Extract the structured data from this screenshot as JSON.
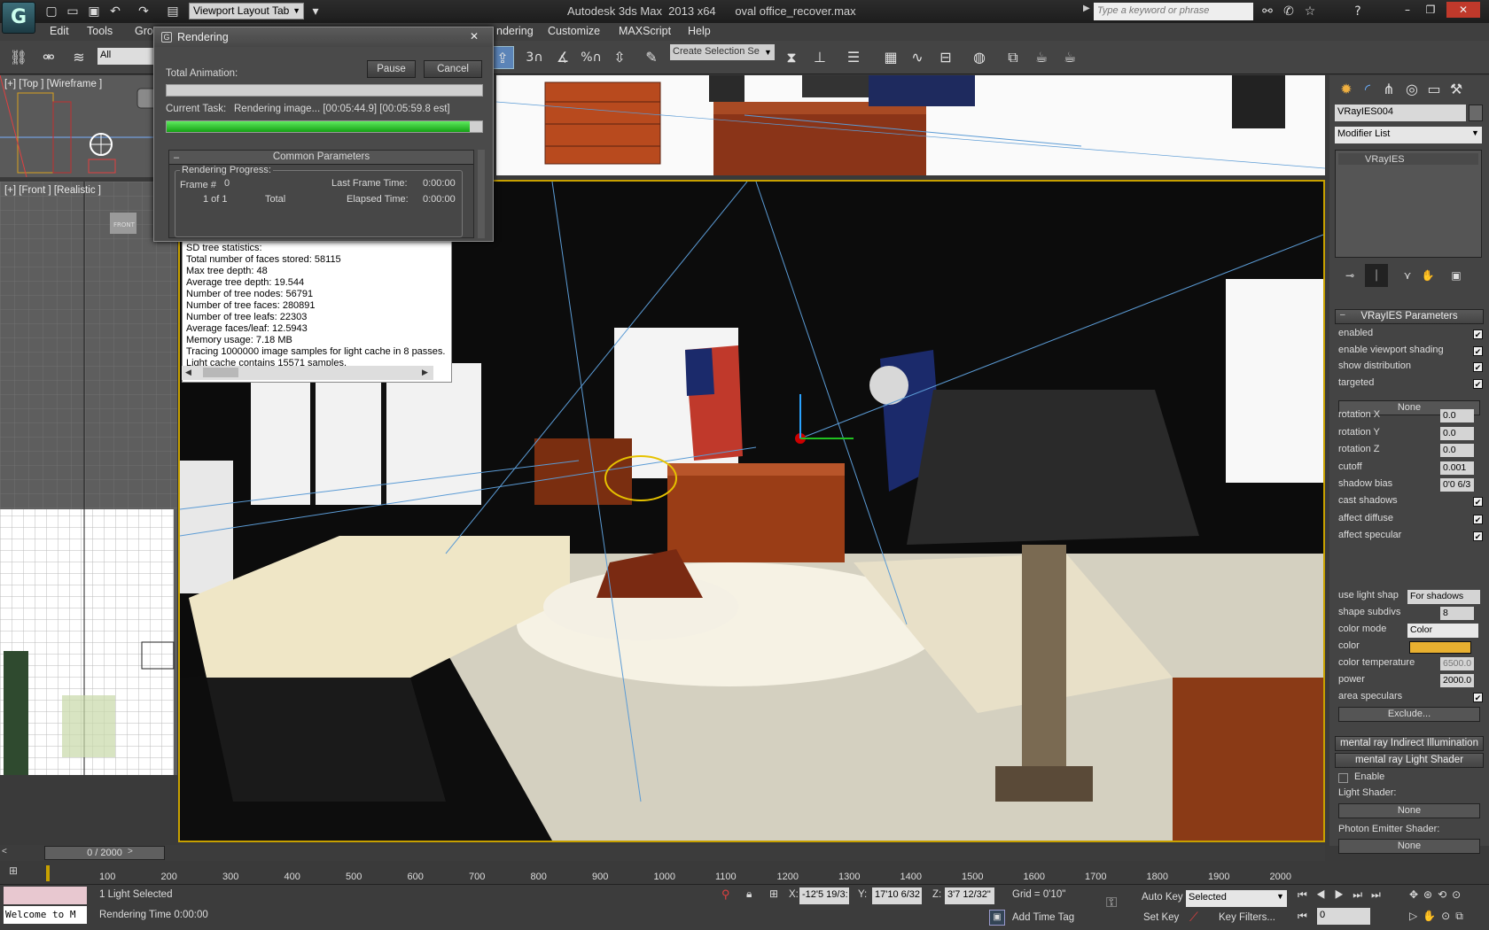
{
  "app": {
    "title": "Autodesk 3ds Max  2013 x64      oval office_recover.max",
    "logo": "G",
    "workspace": "Viewport Layout Tab",
    "search_placeholder": "Type a keyword or phrase"
  },
  "menu": [
    "Edit",
    "Tools",
    "Gro",
    "ndering",
    "Customize",
    "MAXScript",
    "Help"
  ],
  "toolbar": {
    "selection_filter": "All",
    "named_selection_placeholder": "Create Selection Se",
    "snap_labels": [
      "3",
      "%"
    ]
  },
  "viewports": {
    "top_label": "[+] [Top ] [Wireframe ]",
    "front_label": "[+] [Front ] [Realistic ]",
    "front_tag": "FRONT"
  },
  "render_dialog": {
    "title": "Rendering",
    "total_animation_label": "Total Animation:",
    "pause_label": "Pause",
    "cancel_label": "Cancel",
    "current_task_label": "Current Task:",
    "current_task_value": "Rendering image... [00:05:44.9] [00:05:59.8 est]",
    "current_task_progress": 0.96,
    "total_animation_progress": 0.0,
    "common_params_header": "Common Parameters",
    "rendering_progress_label": "Rendering Progress:",
    "frame_label": "Frame #",
    "frame_value": "0",
    "frame_of": "1 of 1",
    "total_label": "Total",
    "last_frame_time_label": "Last Frame Time:",
    "last_frame_time_value": "0:00:00",
    "elapsed_time_label": "Elapsed Time:",
    "elapsed_time_value": "0:00:00"
  },
  "log_lines": [
    "SD tree statistics:",
    "Total number of faces stored: 58115",
    "Max tree depth: 48",
    "Average tree depth: 19.544",
    "Number of tree nodes: 56791",
    "Number of tree faces: 280891",
    "Number of tree leafs: 22303",
    "Average faces/leaf: 12.5943",
    "Memory usage: 7.18 MB",
    "Tracing 1000000 image samples for light cache in 8 passes.",
    "Light cache contains 15571 samples."
  ],
  "command_panel": {
    "object_name": "VRayIES004",
    "modifier_list": "Modifier List",
    "stack_item": "VRayIES",
    "params_header": "VRayIES Parameters",
    "rows": [
      {
        "label": "enabled",
        "checked": true
      },
      {
        "label": "enable viewport shading",
        "checked": true
      },
      {
        "label": "show distribution",
        "checked": true
      },
      {
        "label": "targeted",
        "checked": true
      }
    ],
    "none_button": "None",
    "spinners": [
      {
        "label": "rotation X",
        "value": "0.0"
      },
      {
        "label": "rotation Y",
        "value": "0.0"
      },
      {
        "label": "rotation Z",
        "value": "0.0"
      },
      {
        "label": "cutoff",
        "value": "0.001"
      },
      {
        "label": "shadow bias",
        "value": "0'0 6/3"
      }
    ],
    "rows2": [
      {
        "label": "cast shadows",
        "checked": true
      },
      {
        "label": "affect diffuse",
        "checked": true
      },
      {
        "label": "affect specular",
        "checked": true
      }
    ],
    "use_light_shape_label": "use light shap",
    "use_light_shape_value": "For shadows",
    "shape_subdivs_label": "shape subdivs",
    "shape_subdivs_value": "8",
    "color_mode_label": "color mode",
    "color_mode_value": "Color",
    "color_label": "color",
    "color_swatch": "#e8b030",
    "color_temp_label": "color temperature",
    "color_temp_value": "6500.0",
    "power_label": "power",
    "power_value": "2000.0",
    "area_speculars_label": "area speculars",
    "area_speculars_checked": true,
    "exclude_button": "Exclude...",
    "mr_indirect_header": "mental ray Indirect Illumination",
    "mr_light_shader_header": "mental ray Light Shader",
    "enable_label": "Enable",
    "light_shader_label": "Light Shader:",
    "light_shader_value": "None",
    "photon_label": "Photon Emitter Shader:",
    "photon_value": "None"
  },
  "timeline": {
    "position": "0 / 2000",
    "ticks": [
      "100",
      "200",
      "300",
      "400",
      "500",
      "600",
      "700",
      "800",
      "900",
      "1000",
      "1100",
      "1200",
      "1300",
      "1400",
      "1500",
      "1600",
      "1700",
      "1800",
      "1900",
      "2000"
    ]
  },
  "status": {
    "maxscript_text": "Welcome to M",
    "selection": "1 Light Selected",
    "render_time": "Rendering Time  0:00:00",
    "x_label": "X:",
    "x_value": "-12'5 19/3:",
    "y_label": "Y:",
    "y_value": "17'10 6/32",
    "z_label": "Z:",
    "z_value": "3'7 12/32\"",
    "grid": "Grid = 0'10\"",
    "add_time_tag": "Add Time Tag",
    "auto_key": "Auto Key",
    "set_key": "Set Key",
    "key_mode": "Selected",
    "key_filters": "Key Filters...",
    "frame_field": "0"
  }
}
